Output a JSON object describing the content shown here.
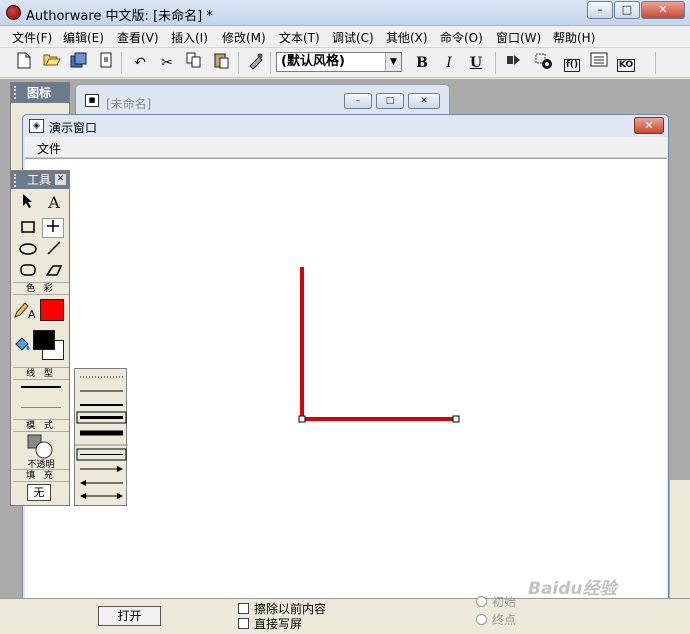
{
  "app": {
    "title": "Authorware 中文版: [未命名] *",
    "window_buttons": {
      "minimize": "–",
      "maximize": "□",
      "close": "✕"
    }
  },
  "menu": [
    {
      "label": "文件(F)"
    },
    {
      "label": "编辑(E)"
    },
    {
      "label": "查看(V)"
    },
    {
      "label": "插入(I)"
    },
    {
      "label": "修改(M)"
    },
    {
      "label": "文本(T)"
    },
    {
      "label": "调试(C)"
    },
    {
      "label": "其他(X)"
    },
    {
      "label": "命令(O)"
    },
    {
      "label": "窗口(W)"
    },
    {
      "label": "帮助(H)"
    }
  ],
  "toolbar": {
    "style_value": "(默认风格)",
    "bold": "B",
    "italic": "I",
    "underline": "U",
    "func_label": "f()",
    "ko_label": "KO",
    "icons": [
      "new-icon",
      "open-icon",
      "save-all-icon",
      "import-icon",
      "undo-icon",
      "cut-icon",
      "copy-icon",
      "paste-icon",
      "find-icon",
      "run-icon",
      "control-panel-icon",
      "functions-icon",
      "variables-icon",
      "knowledge-objects-icon"
    ]
  },
  "icon_palette": {
    "title": "图标"
  },
  "flow_window": {
    "title": "[未命名]"
  },
  "presentation_window": {
    "title": "演示窗口",
    "menu_file": "文件",
    "drawing": {
      "color": "#dd0000",
      "description": "L-shaped red line"
    }
  },
  "tool_palette": {
    "title": "工具",
    "close": "☒",
    "text_tool": "A",
    "color_label": "色 彩",
    "line_label": "线 型",
    "mode_label": "模 式",
    "mode_value": "不透明",
    "fill_label": "填 充",
    "fill_value": "无",
    "foreground_color": "#ff0000",
    "fill_color": "#000000"
  },
  "properties": {
    "open_button": "打开",
    "erase_previous": "擦除以前内容",
    "direct_to_screen": "直接写屏",
    "start_point": "初始",
    "end_point": "终点"
  },
  "watermark": "Baidu经验"
}
